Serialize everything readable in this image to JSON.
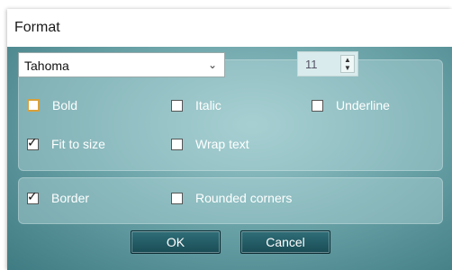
{
  "dialog": {
    "title": "Format"
  },
  "font": {
    "family": "Tahoma",
    "size": "11"
  },
  "options": {
    "bold": {
      "label": "Bold",
      "checked": false
    },
    "italic": {
      "label": "Italic",
      "checked": false
    },
    "underline": {
      "label": "Underline",
      "checked": false
    },
    "fit_to_size": {
      "label": "Fit to size",
      "checked": true
    },
    "wrap_text": {
      "label": "Wrap text",
      "checked": false
    },
    "border": {
      "label": "Border",
      "checked": true
    },
    "rounded_corners": {
      "label": "Rounded corners",
      "checked": false
    }
  },
  "buttons": {
    "ok": "OK",
    "cancel": "Cancel"
  },
  "icons": {
    "dropdown": "chevron-down-icon",
    "spinner": "spin-up-down-icon",
    "checkmark": "checkmark-icon"
  }
}
